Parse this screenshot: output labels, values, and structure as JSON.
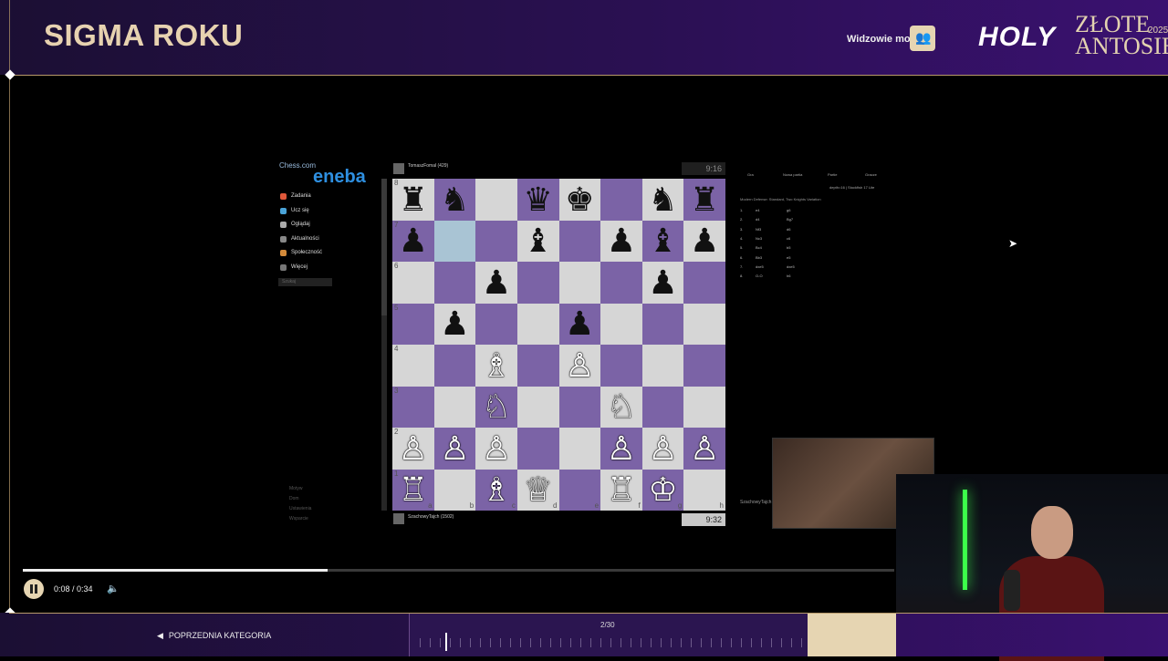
{
  "header": {
    "title": "SIGMA ROKU",
    "viewers_label": "Widzowie mogą",
    "brand_holy": "HOLY",
    "brand_event": "ZŁOTE ANTOSIE",
    "brand_year": "2025"
  },
  "chess": {
    "site_logo": "Chess.com",
    "sponsor": "eneba",
    "nav": [
      "Zadania",
      "Ucz się",
      "Oglądaj",
      "Aktualności",
      "Społeczność",
      "Więcej"
    ],
    "search_placeholder": "Szukaj",
    "footer_nav": [
      "Motyw",
      "Dom",
      "Ustawienia",
      "Wsparcie"
    ],
    "top_player": "TomaszFomal (429)",
    "top_clock": "9:16",
    "bottom_player": "SzachowyTajch (1502)",
    "bottom_clock": "9:32",
    "board": [
      [
        "♜",
        "♞",
        "",
        "♛",
        "♚",
        "",
        "♞",
        "♜"
      ],
      [
        "♟",
        "",
        "",
        "♝",
        "",
        "♟",
        "♝",
        "♟"
      ],
      [
        "",
        "",
        "♟",
        "",
        "",
        "",
        "♟",
        ""
      ],
      [
        "",
        "♟",
        "",
        "",
        "♟",
        "",
        "",
        ""
      ],
      [
        "",
        "",
        "♗",
        "",
        "♙",
        "",
        "",
        ""
      ],
      [
        "",
        "",
        "♘",
        "",
        "",
        "♘",
        "",
        ""
      ],
      [
        "♙",
        "♙",
        "♙",
        "",
        "",
        "♙",
        "♙",
        "♙"
      ],
      [
        "♖",
        "",
        "♗",
        "♕",
        "",
        "♖",
        "♔",
        ""
      ]
    ],
    "board_colors": [
      [
        "w",
        "b",
        "w",
        "b",
        "w",
        "b",
        "w",
        "b"
      ],
      [
        "b",
        "w",
        "b",
        "w",
        "b",
        "w",
        "b",
        "w"
      ],
      [
        "w",
        "b",
        "w",
        "b",
        "w",
        "b",
        "w",
        "b"
      ],
      [
        "b",
        "w",
        "b",
        "w",
        "b",
        "w",
        "b",
        "w"
      ],
      [
        "w",
        "b",
        "w",
        "b",
        "w",
        "b",
        "w",
        "b"
      ],
      [
        "b",
        "w",
        "b",
        "w",
        "b",
        "w",
        "b",
        "w"
      ],
      [
        "w",
        "b",
        "w",
        "b",
        "w",
        "b",
        "w",
        "b"
      ],
      [
        "b",
        "w",
        "b",
        "w",
        "b",
        "w",
        "b",
        "w"
      ]
    ],
    "ranks": [
      "8",
      "7",
      "6",
      "5",
      "4",
      "3",
      "2",
      "1"
    ],
    "files": [
      "a",
      "b",
      "c",
      "d",
      "e",
      "f",
      "g",
      "h"
    ],
    "tabs": [
      "Gra",
      "Nowa partia",
      "Partie",
      "Gracze"
    ],
    "engine_line": "depth=16 | Stockfish 17 Lite",
    "opening": "Modern Defense: Standard, Two Knights Variation",
    "moves": [
      [
        "1.",
        "e4",
        "g6"
      ],
      [
        "2.",
        "d4",
        "Bg7"
      ],
      [
        "3.",
        "Nf3",
        "d6"
      ],
      [
        "4.",
        "Nc3",
        "c6"
      ],
      [
        "5.",
        "Bc4",
        "b5"
      ],
      [
        "6.",
        "Bb3",
        "e5"
      ],
      [
        "7.",
        "dxe5",
        "dxe5"
      ],
      [
        "8.",
        "O-O",
        "h6"
      ]
    ],
    "cam_side_text": "SzachowyTajch"
  },
  "player": {
    "time": "0:08 / 0:34",
    "progress": 0.35,
    "prev_category": "POPRZEDNIA KATEGORIA",
    "counter": "2/30"
  },
  "colors": {
    "accent_gold": "#e6d5b2",
    "purple_dark": "#1b0f33",
    "board_dark": "#7b63a6",
    "board_light": "#d6d6d6"
  }
}
